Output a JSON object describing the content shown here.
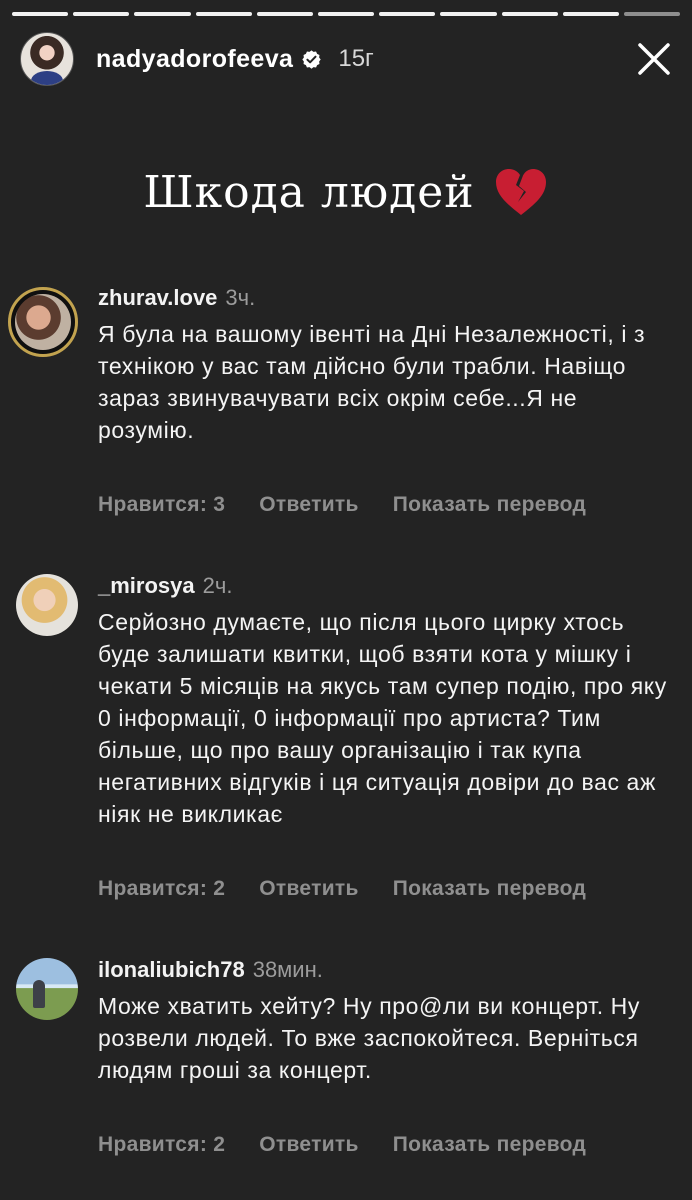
{
  "story": {
    "username": "nadyadorofeeva",
    "time": "15г",
    "title": "Шкода людей"
  },
  "comments": [
    {
      "username": "zhurav.love",
      "time": "3ч.",
      "text": "Я була на вашому івенті на Дні Незалежності, і з технікою у вас там дійсно були трабли. Навіщо зараз звинувачувати всіх окрім себе...Я не розумію.",
      "likes": "Нравится: 3",
      "reply": "Ответить",
      "translate": "Показать перевод"
    },
    {
      "username": "_mirosya",
      "time": "2ч.",
      "text": "Серйозно думаєте, що після цього цирку хтось буде залишати квитки, щоб взяти кота у мішку і чекати 5 місяців на якусь там супер подію, про яку 0 інформації, 0 інформації про артиста? Тим більше, що про вашу організацію і так купа негативних відгуків і ця ситуація довіри до вас аж ніяк не викликає",
      "likes": "Нравится: 2",
      "reply": "Ответить",
      "translate": "Показать перевод"
    },
    {
      "username": "ilonaliubich78",
      "time": "38мин.",
      "text": "Може хватить хейту? Ну про@ли ви концерт. Ну розвели людей. То вже заспокойтеся. Верніться людям гроші за концерт.",
      "likes": "Нравится: 2",
      "reply": "Ответить",
      "translate": "Показать перевод"
    }
  ],
  "colors": {
    "background": "#232323",
    "text": "#ffffff",
    "secondary_text": "#8f8f8f",
    "verified": "#ffffff",
    "heart": "#c81e32"
  },
  "icons": {
    "verified": "verified-badge-icon",
    "close": "close-icon",
    "heart": "broken-heart-icon"
  }
}
